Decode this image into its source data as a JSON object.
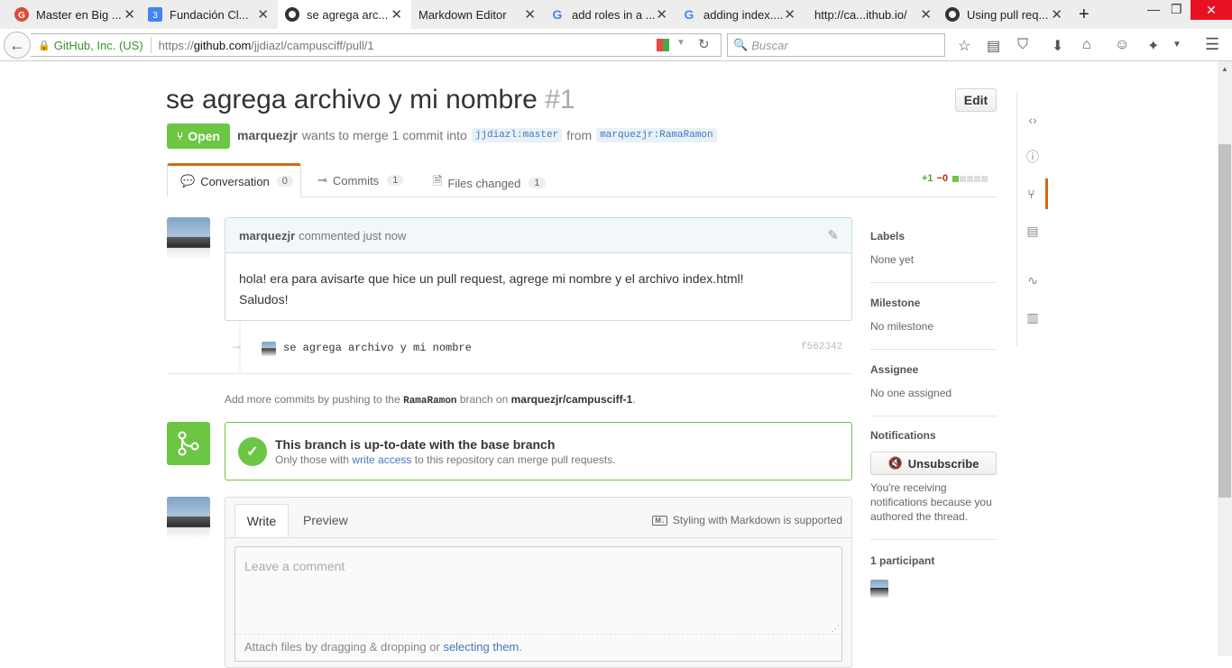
{
  "browser": {
    "tabs": [
      {
        "title": "Master en Big ...",
        "icon": "google-plus-icon",
        "color": "#dd4b39",
        "active": false
      },
      {
        "title": "Fundación Cl...",
        "icon": "calendar-icon",
        "color": "#4285f4",
        "active": false
      },
      {
        "title": "se agrega arc...",
        "icon": "github-icon",
        "color": "#333333",
        "active": true
      },
      {
        "title": "Markdown Editor",
        "icon": "",
        "color": "",
        "active": false
      },
      {
        "title": "add roles in a ...",
        "icon": "google-icon",
        "color": "#4285f4",
        "active": false
      },
      {
        "title": "adding index....",
        "icon": "google-icon",
        "color": "#4285f4",
        "active": false
      },
      {
        "title": "http://ca...ithub.io/",
        "icon": "",
        "color": "",
        "active": false
      },
      {
        "title": "Using pull req...",
        "icon": "github-icon",
        "color": "#333333",
        "active": false
      }
    ],
    "new_tab": "+",
    "site_identity": "GitHub, Inc. (US)",
    "url_prefix": "https://",
    "url_domain": "github.com",
    "url_path": "/jjdiazl/campusciff/pull/1",
    "search_placeholder": "Buscar"
  },
  "pr": {
    "title": "se agrega archivo y mi nombre",
    "number": "#1",
    "edit_label": "Edit",
    "state": "Open",
    "author": "marquezjr",
    "merge_text": "wants to merge 1 commit into",
    "base_branch": "jjdiazl:master",
    "from_text": "from",
    "head_branch": "marquezjr:RamaRamon"
  },
  "tabs": {
    "conversation": {
      "label": "Conversation",
      "count": "0"
    },
    "commits": {
      "label": "Commits",
      "count": "1"
    },
    "files": {
      "label": "Files changed",
      "count": "1"
    },
    "diffstat": {
      "added": "+1",
      "removed": "−0"
    }
  },
  "comment": {
    "author": "marquezjr",
    "meta": "commented just now",
    "line1": "hola! era para avisarte que hice un pull request, agrege mi nombre y el archivo index.html!",
    "line2": "Saludos!"
  },
  "commit": {
    "message": "se agrega archivo y mi nombre",
    "sha": "f562342"
  },
  "push_hint": {
    "prefix": "Add more commits by pushing to the",
    "branch": "RamaRamon",
    "middle": "branch on",
    "repo": "marquezjr/campusciff-1",
    "suffix": "."
  },
  "merge_box": {
    "title": "This branch is up-to-date with the base branch",
    "sub_prefix": "Only those with",
    "sub_link": "write access",
    "sub_suffix": "to this repository can merge pull requests."
  },
  "composer": {
    "write_tab": "Write",
    "preview_tab": "Preview",
    "markdown_hint": "Styling with Markdown is supported",
    "placeholder": "Leave a comment",
    "attach_prefix": "Attach files by dragging & dropping or",
    "attach_link": "selecting them",
    "attach_suffix": "."
  },
  "sidebar": {
    "labels_h": "Labels",
    "labels_v": "None yet",
    "milestone_h": "Milestone",
    "milestone_v": "No milestone",
    "assignee_h": "Assignee",
    "assignee_v": "No one assigned",
    "notifications_h": "Notifications",
    "unsubscribe": "Unsubscribe",
    "notif_note": "You're receiving notifications because you authored the thread.",
    "participants_h": "1 participant"
  },
  "colors": {
    "green": "#6cc644",
    "link": "#4078c0",
    "orange": "#d26911"
  }
}
